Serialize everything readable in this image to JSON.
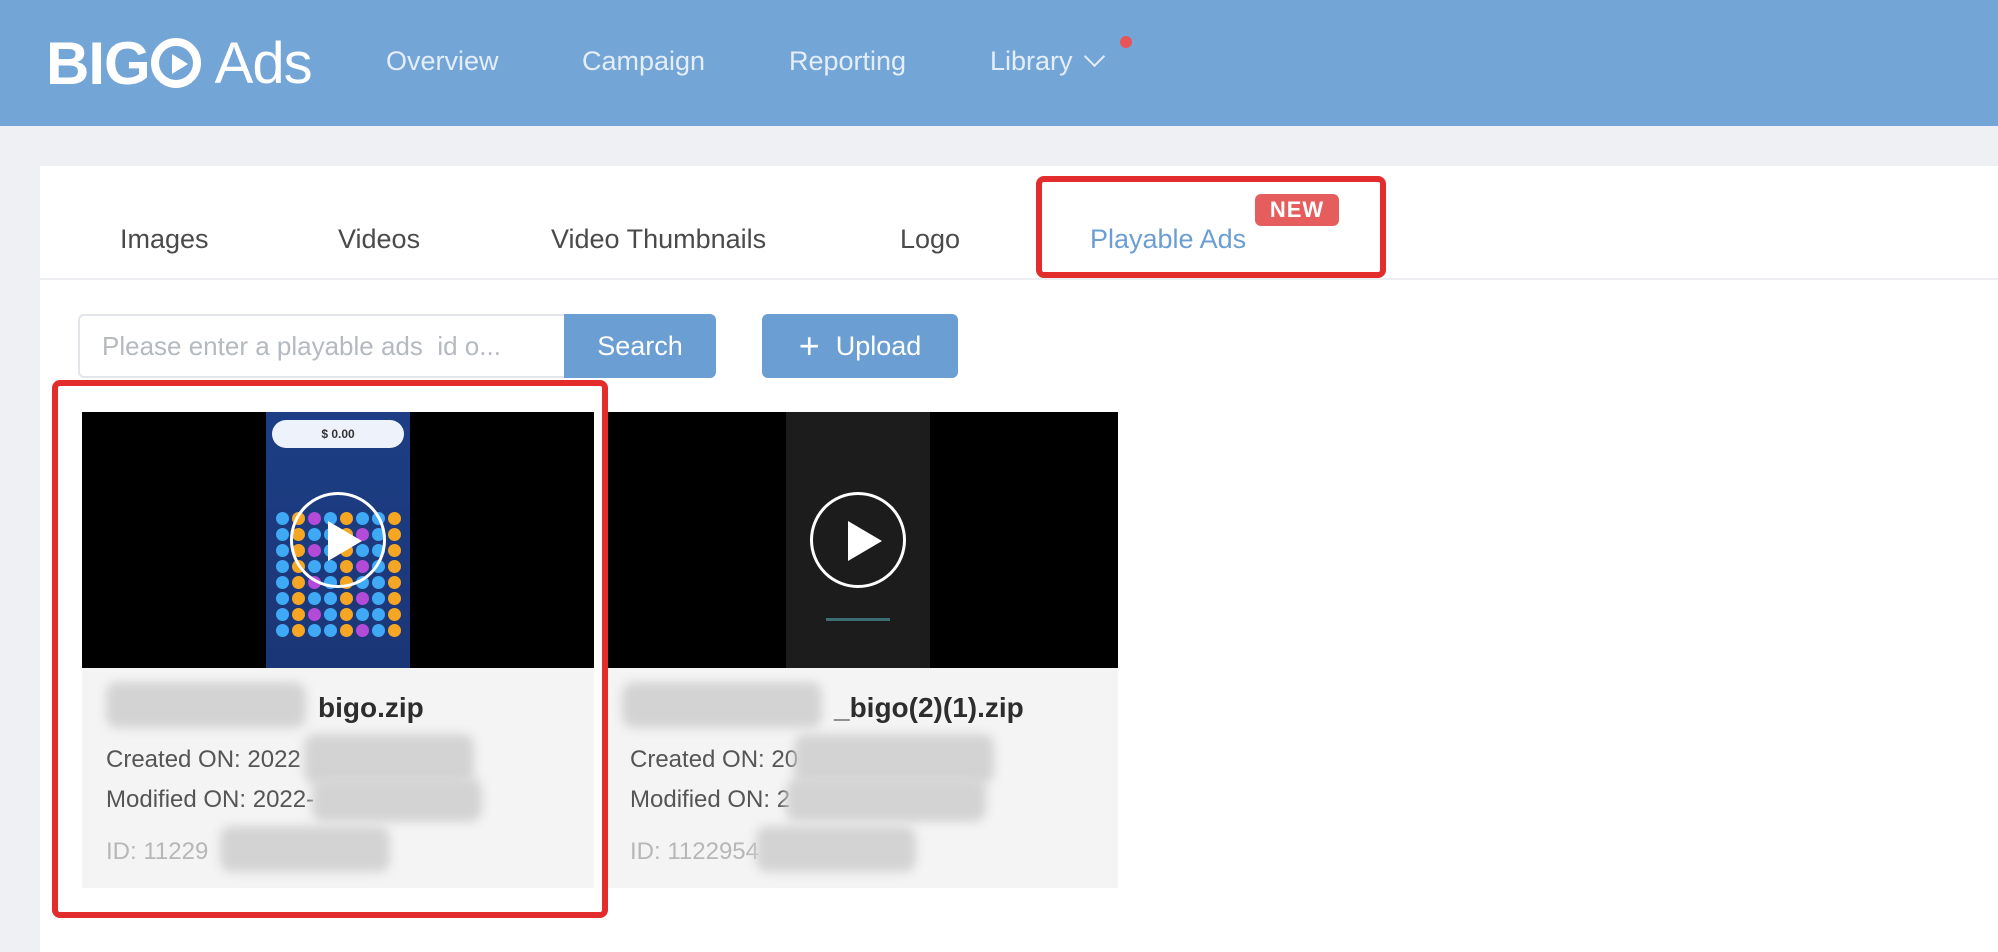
{
  "header": {
    "logo": {
      "brand": "BIG",
      "suffix": "Ads"
    },
    "nav": [
      {
        "label": "Overview"
      },
      {
        "label": "Campaign"
      },
      {
        "label": "Reporting"
      },
      {
        "label": "Library"
      }
    ],
    "colors": {
      "bar": "#73a5d6",
      "notification_dot": "#e8545a"
    }
  },
  "tabs": {
    "items": [
      {
        "label": "Images"
      },
      {
        "label": "Videos"
      },
      {
        "label": "Video Thumbnails"
      },
      {
        "label": "Logo"
      },
      {
        "label": "Playable Ads"
      }
    ],
    "active": "Playable Ads",
    "new_badge": "NEW"
  },
  "toolbar": {
    "search_placeholder": "Please enter a playable ads  id o...",
    "search_label": "Search",
    "upload_icon": "+",
    "upload_label": "Upload"
  },
  "cards": [
    {
      "name_visible": "bigo.zip",
      "created_label": "Created ON: 2022",
      "modified_label": "Modified ON: 2022-",
      "id_label": "ID: 11229",
      "thumb": {
        "wallet_text": "$ 0.00"
      },
      "icon": "play-circle-icon"
    },
    {
      "name_visible": "_bigo(2)(1).zip",
      "created_label": "Created ON: 20",
      "modified_label": "Modified ON: 2",
      "id_label": "ID: 1122954",
      "icon": "play-circle-icon"
    }
  ],
  "accent_colors": {
    "primary": "#6b9ed3",
    "highlight": "#e32d2d",
    "badge": "#e55d5d"
  }
}
